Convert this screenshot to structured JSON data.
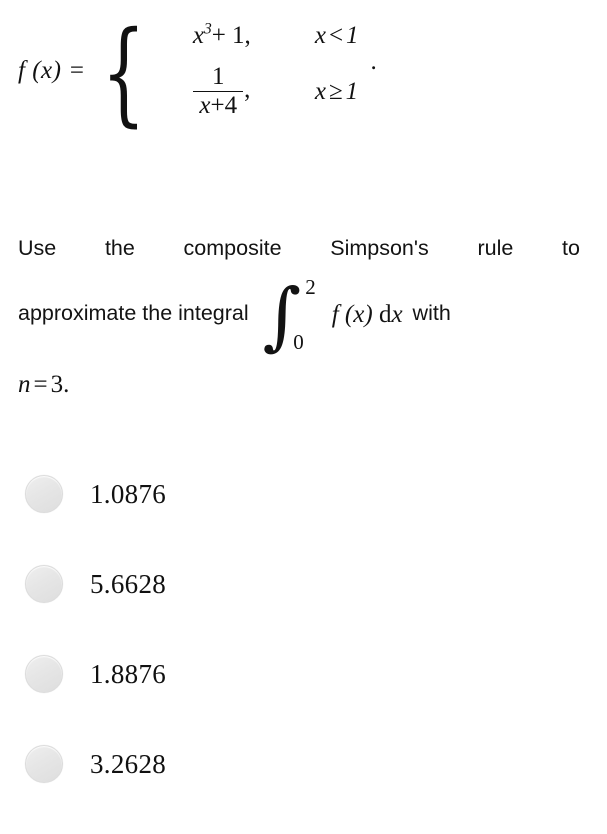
{
  "function_definition": {
    "name": "f",
    "variable": "x",
    "lhs": "f (x) =",
    "cases": [
      {
        "expression_base": "x",
        "expression_exponent": "3",
        "expression_tail": "+ 1,",
        "condition_var": "x",
        "condition_op": "<",
        "condition_value": "1"
      },
      {
        "numerator": "1",
        "denominator_var": "x",
        "denominator_op": "+",
        "denominator_value": "4",
        "comma": ",",
        "condition_var": "x",
        "condition_op": "≥",
        "condition_value": "1"
      }
    ],
    "trailing_punctuation": "."
  },
  "prompt": {
    "line1_words": [
      "Use",
      "the",
      "composite",
      "Simpson's",
      "rule",
      "to"
    ],
    "line2_prefix": "approximate the integral",
    "integral": {
      "symbol": "∫",
      "lower_limit": "0",
      "upper_limit": "2",
      "integrand": "f (x)",
      "differential": "dx"
    },
    "line2_suffix": "with",
    "line3_var": "n",
    "line3_eq": "=",
    "line3_value": "3",
    "line3_period": "."
  },
  "options": [
    {
      "id": "option-a",
      "label": "1.0876",
      "selected": false
    },
    {
      "id": "option-b",
      "label": "5.6628",
      "selected": false
    },
    {
      "id": "option-c",
      "label": "1.8876",
      "selected": false
    },
    {
      "id": "option-d",
      "label": "3.2628",
      "selected": false
    }
  ],
  "colors": {
    "background": "#ffffff",
    "text": "#111111",
    "radio_fill": "#e8e8e8",
    "radio_border": "#dcdcdc"
  }
}
